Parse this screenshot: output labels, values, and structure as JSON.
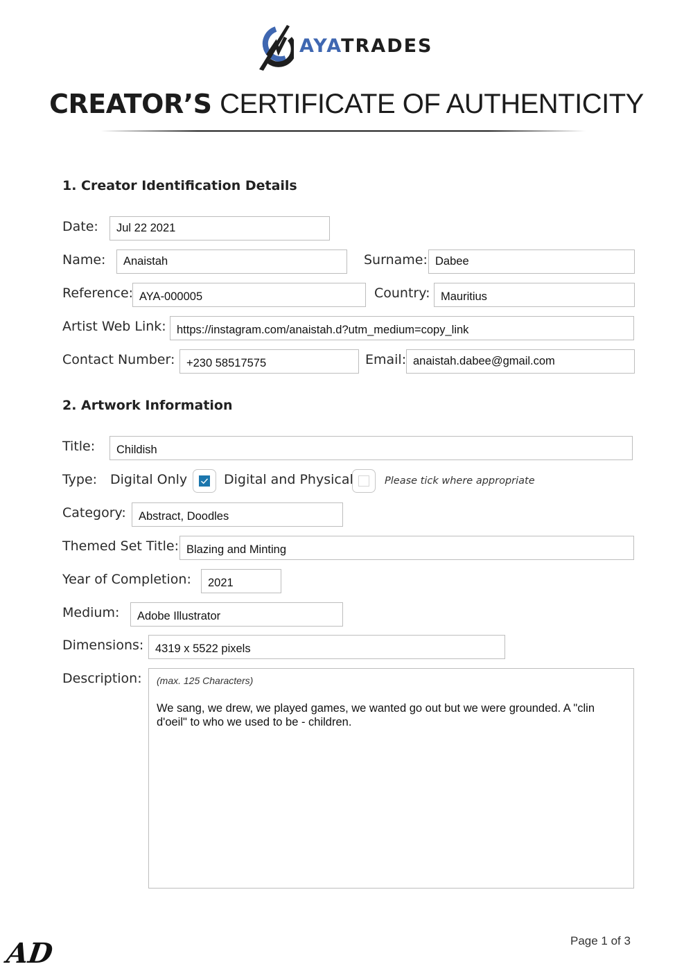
{
  "brand": {
    "logo_icon": "ayatrades-arrow-logo-icon",
    "name_part1": "AYA",
    "name_part2": "TRADES",
    "colors": {
      "blue": "#3f67b1",
      "dark": "#1e1e1e"
    }
  },
  "document": {
    "title_bold": "CREATOR’S",
    "title_light": "CERTIFICATE OF AUTHENTICITY"
  },
  "section1": {
    "heading": "1. Creator Identification Details",
    "fields": {
      "date": {
        "label": "Date:",
        "value": "Jul 22 2021"
      },
      "name": {
        "label": "Name:",
        "value": "Anaistah"
      },
      "surname": {
        "label": "Surname:",
        "value": "Dabee"
      },
      "reference": {
        "label": "Reference:",
        "value": "AYA-000005"
      },
      "country": {
        "label": "Country:",
        "value": "Mauritius"
      },
      "web_link": {
        "label": "Artist Web Link:",
        "value": "https://instagram.com/anaistah.d?utm_medium=copy_link"
      },
      "contact": {
        "label": "Contact Number:",
        "value": "+230 58517575"
      },
      "email": {
        "label": "Email:",
        "value": "anaistah.dabee@gmail.com"
      }
    }
  },
  "section2": {
    "heading": "2. Artwork Information",
    "fields": {
      "title": {
        "label": "Title:",
        "value": "Childish"
      },
      "type": {
        "label": "Type:",
        "options": [
          {
            "label": "Digital Only",
            "checked": true,
            "check_color": "#1b76ad"
          },
          {
            "label": "Digital and Physical",
            "checked": false
          }
        ],
        "hint": "Please tick where appropriate"
      },
      "category": {
        "label": "Category:",
        "value": "Abstract, Doodles"
      },
      "themed_set": {
        "label": "Themed Set Title:",
        "value": "Blazing and Minting"
      },
      "year": {
        "label": "Year of Completion:",
        "value": "2021"
      },
      "medium": {
        "label": "Medium:",
        "value": "Adobe Illustrator"
      },
      "dimensions": {
        "label": "Dimensions:",
        "value": "4319 x 5522 pixels"
      },
      "description": {
        "label": "Description:",
        "hint": "(max. 125 Characters)",
        "value": "We sang, we drew, we played games, we wanted go out but we were grounded. A \"clin d'oeil\" to who we used to be - children."
      }
    }
  },
  "footer": {
    "signature": "AD",
    "page": "Page 1 of 3"
  }
}
